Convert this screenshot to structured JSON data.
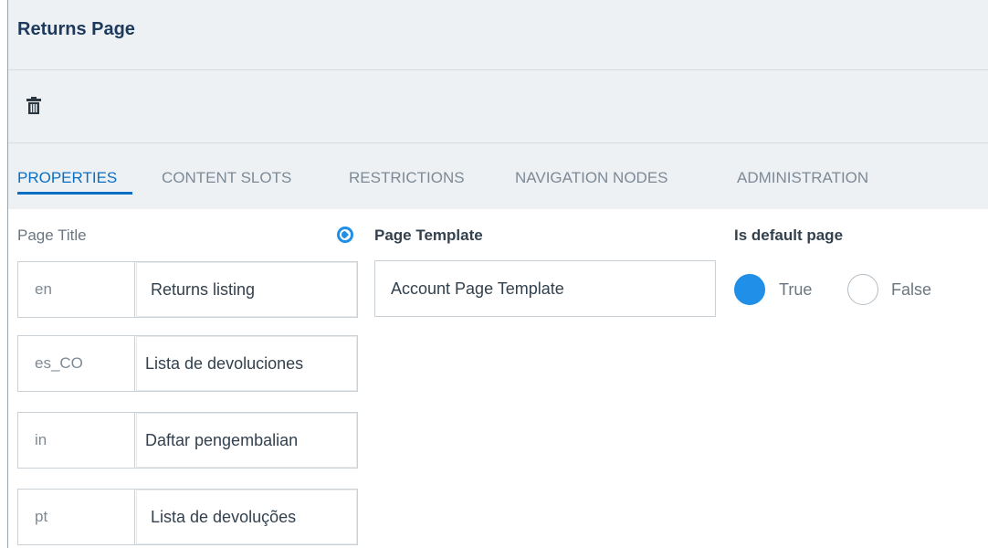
{
  "header": {
    "title": "Returns Page"
  },
  "toolbar": {
    "delete_icon": "trash-icon"
  },
  "tabs": [
    {
      "label": "PROPERTIES",
      "active": true
    },
    {
      "label": "CONTENT SLOTS",
      "active": false
    },
    {
      "label": "RESTRICTIONS",
      "active": false
    },
    {
      "label": "NAVIGATION NODES",
      "active": false
    },
    {
      "label": "ADMINISTRATION",
      "active": false
    }
  ],
  "properties": {
    "page_title_label": "Page Title",
    "localization_icon": "globe-icon",
    "page_title_values": [
      {
        "lang": "en",
        "value": "Returns listing"
      },
      {
        "lang": "es_CO",
        "value": "Lista de devoluciones"
      },
      {
        "lang": "in",
        "value": "Daftar pengembalian"
      },
      {
        "lang": "pt",
        "value": "Lista de devoluções"
      }
    ],
    "page_template_label": "Page Template",
    "page_template_value": "Account Page Template",
    "is_default_label": "Is default page",
    "is_default_options": [
      {
        "label": "True",
        "selected": true
      },
      {
        "label": "False",
        "selected": false
      }
    ]
  },
  "colors": {
    "accent": "#0a6fc2",
    "radio_selected": "#1f8fe8",
    "header_bg": "#eef1f4",
    "title": "#1d3a5c"
  }
}
